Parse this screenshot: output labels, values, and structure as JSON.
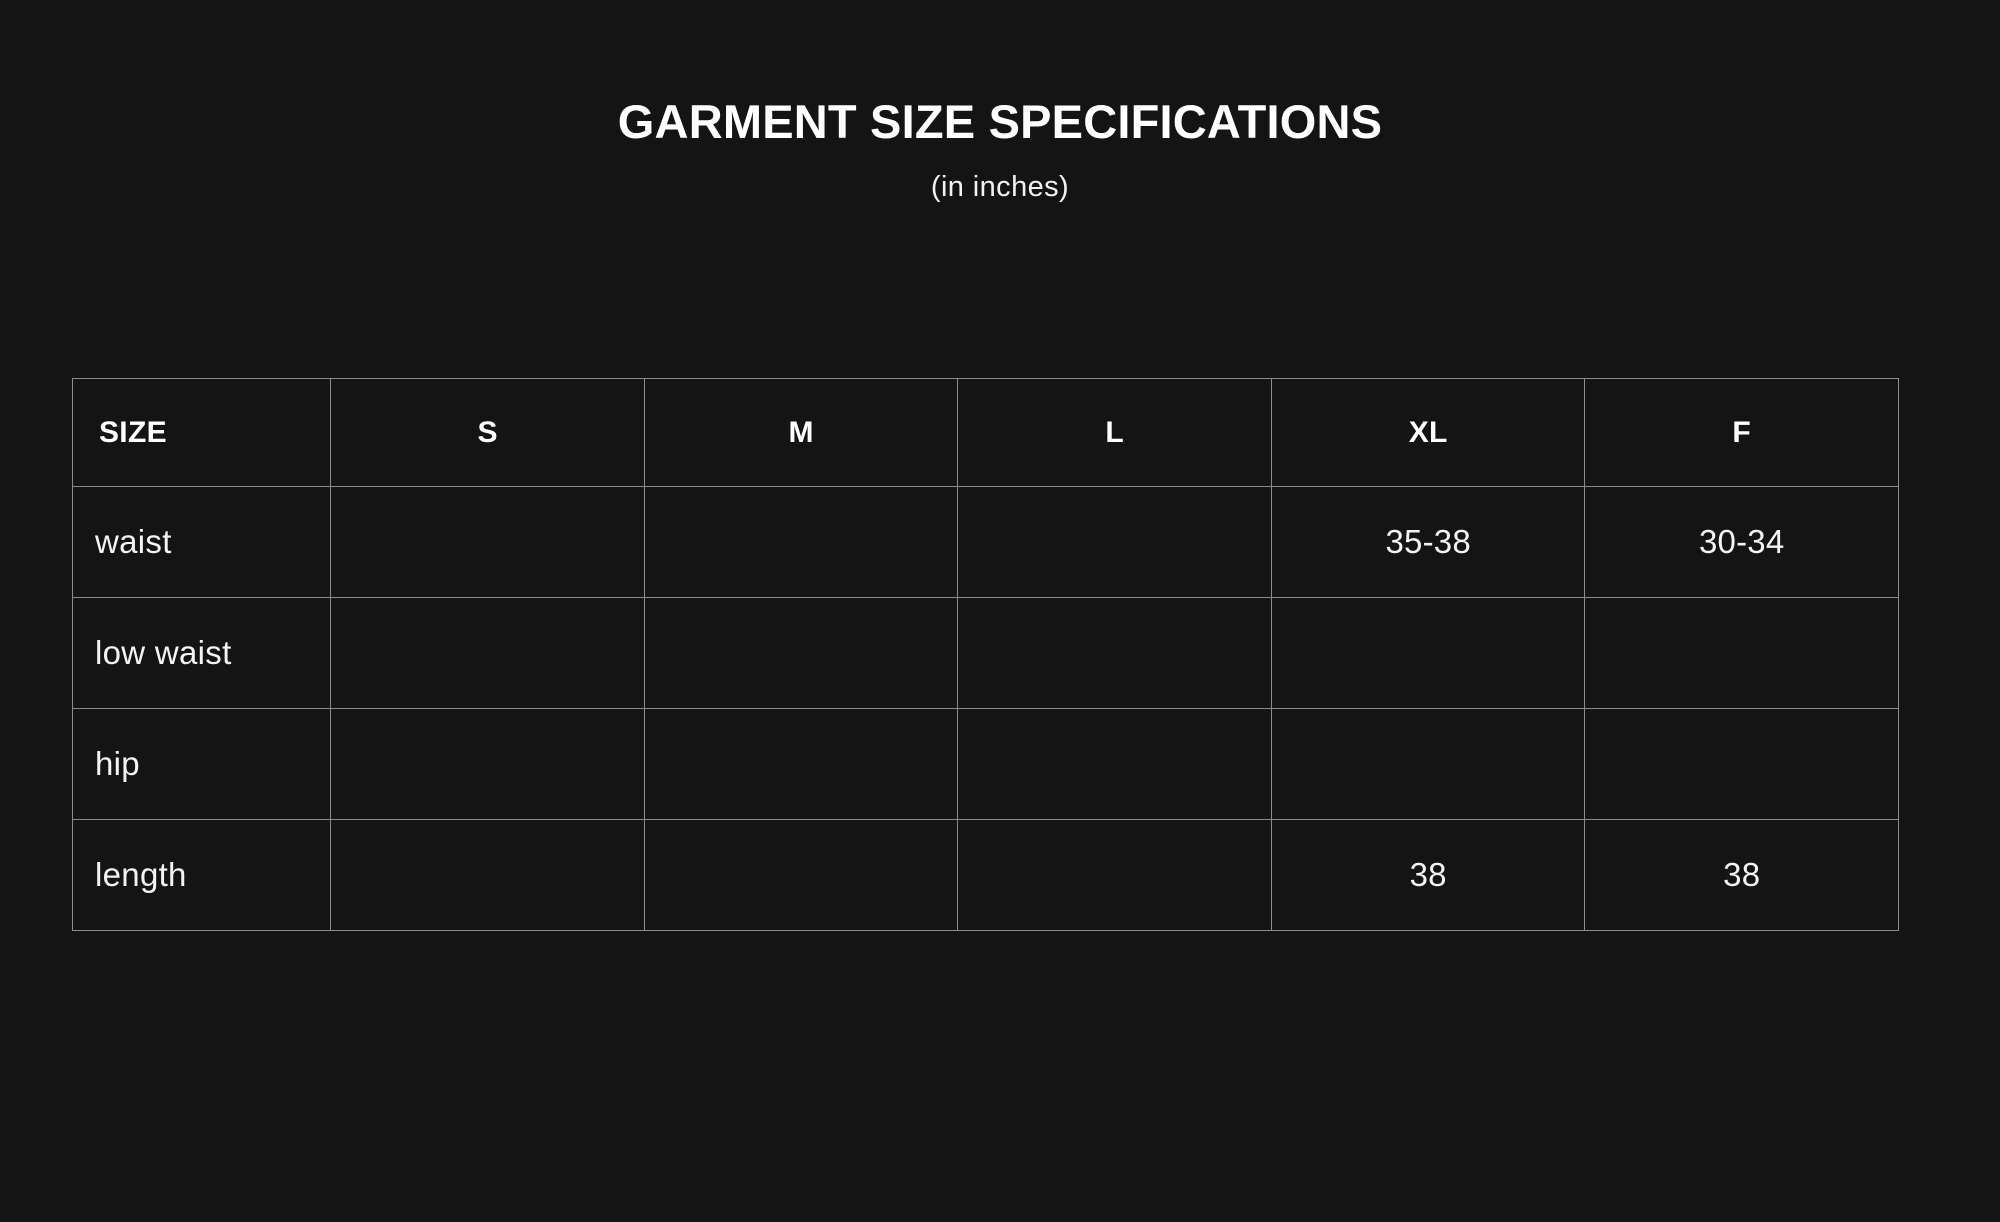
{
  "page": {
    "background_color": "#141414",
    "text_color": "#ffffff",
    "border_color": "#8c8c8c"
  },
  "header": {
    "title": "GARMENT SIZE SPECIFICATIONS",
    "subtitle": "(in inches)"
  },
  "table": {
    "columns": [
      "SIZE",
      "S",
      "M",
      "L",
      "XL",
      "F"
    ],
    "rows": [
      {
        "label": "waist",
        "values": [
          "",
          "",
          "",
          "35-38",
          "30-34"
        ]
      },
      {
        "label": "low waist",
        "values": [
          "",
          "",
          "",
          "",
          ""
        ]
      },
      {
        "label": "hip",
        "values": [
          "",
          "",
          "",
          "",
          ""
        ]
      },
      {
        "label": "length",
        "values": [
          "",
          "",
          "",
          "38",
          "38"
        ]
      }
    ]
  }
}
